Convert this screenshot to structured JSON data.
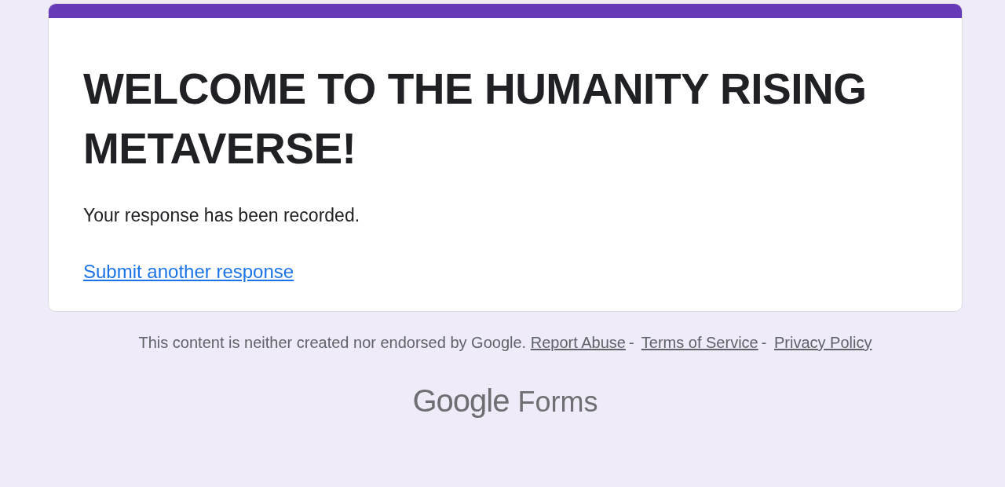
{
  "form": {
    "title": "WELCOME TO THE HUMANITY RISING METAVERSE!",
    "message": "Your response has been recorded.",
    "link": "Submit another response"
  },
  "footer": {
    "disclaimer": "This content is neither created nor endorsed by Google.",
    "links": [
      {
        "label": "Report Abuse"
      },
      {
        "label": "Terms of Service"
      },
      {
        "label": "Privacy Policy"
      }
    ],
    "separator": "-",
    "logo": {
      "brand": "Google",
      "product": "Forms"
    }
  }
}
